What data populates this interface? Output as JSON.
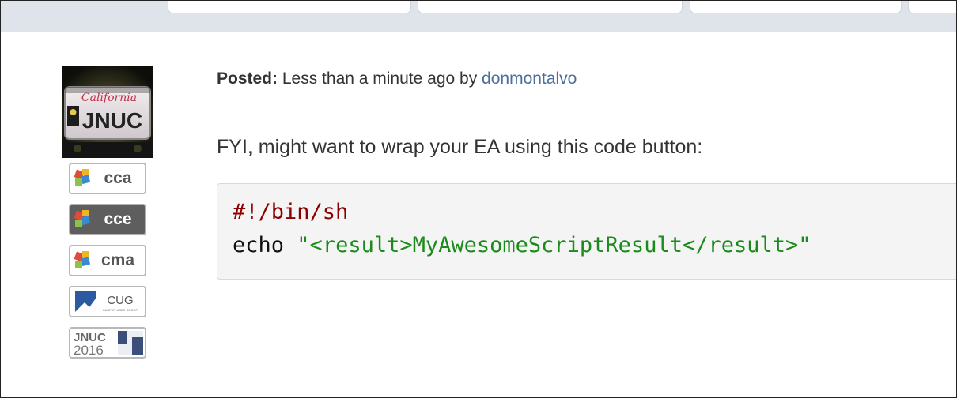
{
  "post": {
    "posted_label": "Posted:",
    "time_text": "Less than a minute ago by",
    "author": "donmontalvo",
    "message": "FYI, might want to wrap your EA using this code button:"
  },
  "code": {
    "line1": "#!/bin/sh",
    "line2_cmd": "echo",
    "line2_string": "\"<result>MyAwesomeScriptResult</result>\""
  },
  "badges": {
    "cca": "cca",
    "cce": "cce",
    "cma": "cma",
    "cug": "CUG",
    "cug_sub": "CASPER USER GROUP",
    "jnuc_top": "JNUC",
    "jnuc_bottom": "2016"
  },
  "avatar": {
    "plate_state": "California",
    "plate_text": "JNUC"
  },
  "colors": {
    "link": "#4a6f9d",
    "shebang": "#8b0000",
    "string": "#1a8a1a",
    "topbar": "#dfe3ea"
  }
}
